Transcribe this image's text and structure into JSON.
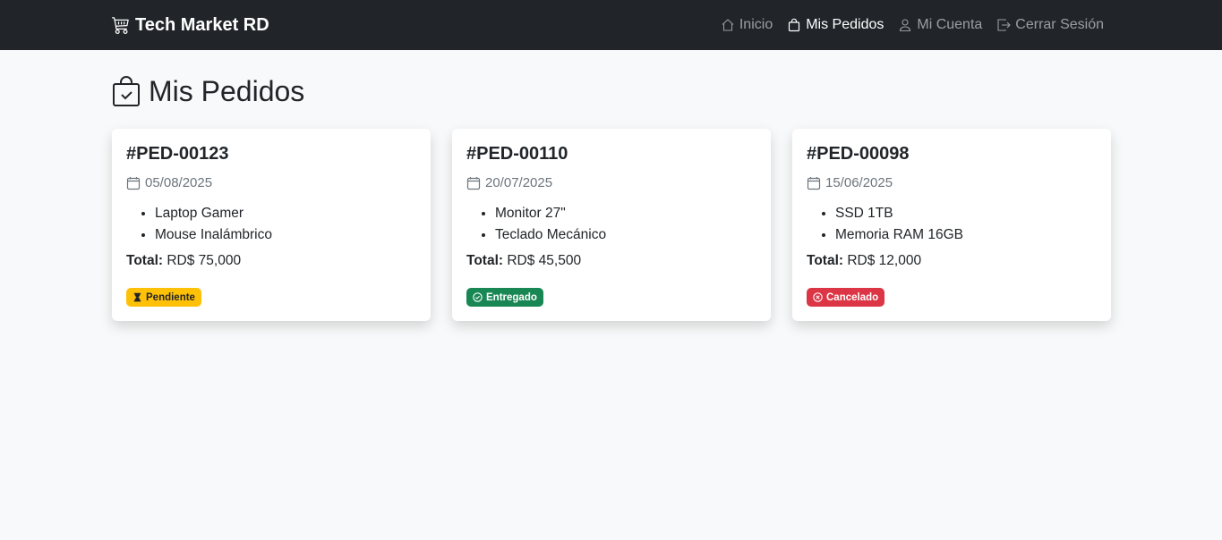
{
  "navbar": {
    "brand": "Tech Market RD",
    "links": [
      {
        "label": "Inicio",
        "icon": "house-icon",
        "active": false
      },
      {
        "label": "Mis Pedidos",
        "icon": "bag-icon",
        "active": true
      },
      {
        "label": "Mi Cuenta",
        "icon": "person-icon",
        "active": false
      },
      {
        "label": "Cerrar Sesión",
        "icon": "logout-icon",
        "active": false
      }
    ]
  },
  "page": {
    "title": "Mis Pedidos"
  },
  "orders": [
    {
      "id": "#PED-00123",
      "date": "05/08/2025",
      "items": [
        "Laptop Gamer",
        "Mouse Inalámbrico"
      ],
      "total_label": "Total:",
      "total": "RD$ 75,000",
      "status": "Pendiente",
      "status_color": "#ffc107",
      "status_icon": "hourglass-icon"
    },
    {
      "id": "#PED-00110",
      "date": "20/07/2025",
      "items": [
        "Monitor 27\"",
        "Teclado Mecánico"
      ],
      "total_label": "Total:",
      "total": "RD$ 45,500",
      "status": "Entregado",
      "status_color": "#198754",
      "status_icon": "check-circle-icon"
    },
    {
      "id": "#PED-00098",
      "date": "15/06/2025",
      "items": [
        "SSD 1TB",
        "Memoria RAM 16GB"
      ],
      "total_label": "Total:",
      "total": "RD$ 12,000",
      "status": "Cancelado",
      "status_color": "#dc3545",
      "status_icon": "x-circle-icon"
    }
  ]
}
